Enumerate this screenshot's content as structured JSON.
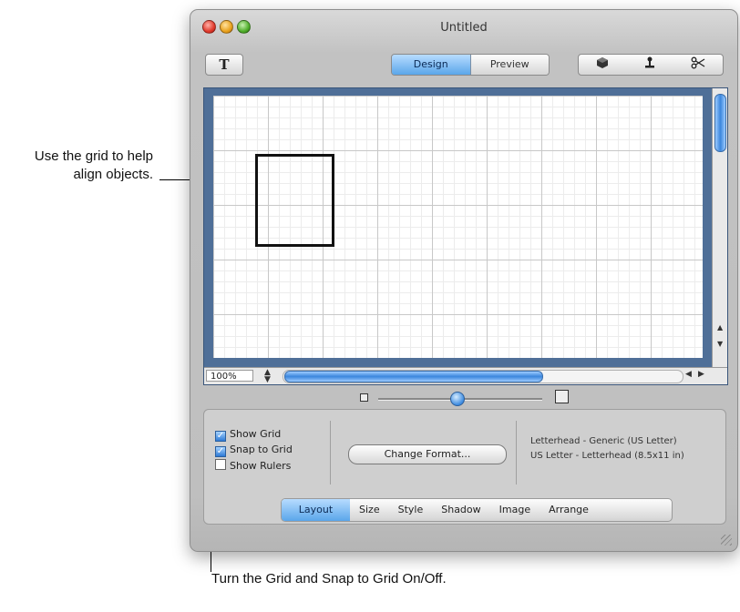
{
  "callouts": {
    "grid_help": "Use the grid to help align objects.",
    "snap_help": "Turn the Grid and Snap to Grid On/Off."
  },
  "window": {
    "title": "Untitled"
  },
  "toolbar": {
    "text_tool": "T",
    "mode_tabs": [
      "Design",
      "Preview"
    ],
    "active_mode": "Design",
    "right_tools": [
      "cube-icon",
      "stamp-icon",
      "scissors-icon"
    ]
  },
  "canvas": {
    "zoom": "100%"
  },
  "panel": {
    "checkboxes": [
      {
        "label": "Show Grid",
        "checked": true
      },
      {
        "label": "Snap to Grid",
        "checked": true
      },
      {
        "label": "Show Rulers",
        "checked": false
      }
    ],
    "change_format_label": "Change Format...",
    "format_line1": "Letterhead - Generic (US Letter)",
    "format_line2": "US Letter - Letterhead (8.5x11 in)",
    "tabs": [
      "Layout",
      "Size",
      "Style",
      "Shadow",
      "Image",
      "Arrange"
    ],
    "active_tab": "Layout"
  },
  "colors": {
    "accent": "#5aa6ea",
    "canvas_frame": "#4f6f98",
    "window_bg": "#c2c2c2"
  }
}
